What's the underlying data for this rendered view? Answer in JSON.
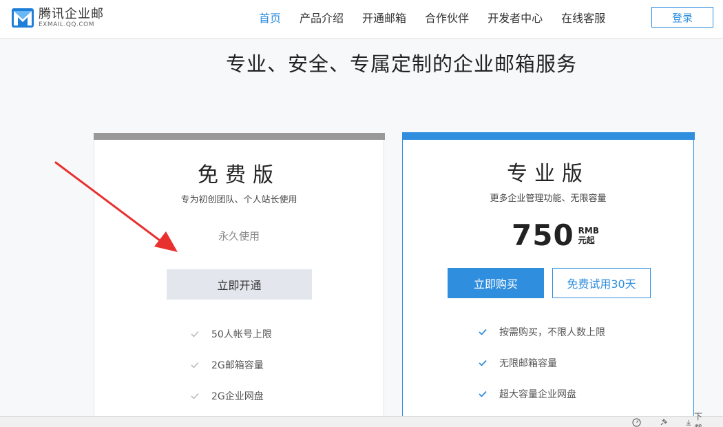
{
  "header": {
    "logo_cn": "腾讯企业邮",
    "logo_en": "EXMAIL.QQ.COM",
    "nav": [
      "首页",
      "产品介绍",
      "开通邮箱",
      "合作伙伴",
      "开发者中心",
      "在线客服"
    ],
    "login_label": "登录"
  },
  "page_title": "专业、安全、专属定制的企业邮箱服务",
  "plans": {
    "free": {
      "name": "免费版",
      "desc": "专为初创团队、个人站长使用",
      "permanent": "永久使用",
      "button": "立即开通",
      "features": [
        "50人帐号上限",
        "2G邮箱容量",
        "2G企业网盘"
      ]
    },
    "pro": {
      "name": "专业版",
      "desc": "更多企业管理功能、无限容量",
      "price": "750",
      "currency": "RMB",
      "price_suffix": "元起",
      "buy_button": "立即购买",
      "trial_button": "免费试用30天",
      "features": [
        "按需购买，不限人数上限",
        "无限邮箱容量",
        "超大容量企业网盘"
      ]
    }
  },
  "statusbar": {
    "download_label": "下载"
  },
  "colors": {
    "accent": "#2f8ede",
    "free_bar": "#999999",
    "arrow": "#e8312f"
  }
}
